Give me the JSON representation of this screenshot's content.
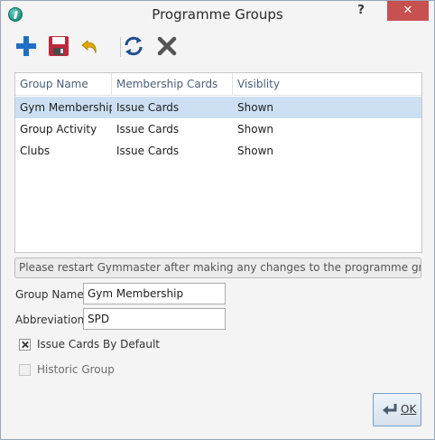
{
  "window": {
    "title": "Programme Groups",
    "help_glyph": "?",
    "close_glyph": "✕"
  },
  "toolbar": {
    "tools": [
      {
        "name": "add-icon"
      },
      {
        "name": "save-icon"
      },
      {
        "name": "undo-icon"
      },
      {
        "name": "refresh-icon"
      },
      {
        "name": "delete-icon"
      }
    ]
  },
  "list": {
    "columns": [
      "Group Name",
      "Membership Cards",
      "Visiblity"
    ],
    "rows": [
      {
        "group": "Gym Membership",
        "cards": "Issue Cards",
        "visibility": "Shown",
        "selected": true
      },
      {
        "group": "Group Activity",
        "cards": "Issue Cards",
        "visibility": "Shown",
        "selected": false
      },
      {
        "group": "Clubs",
        "cards": "Issue Cards",
        "visibility": "Shown",
        "selected": false
      }
    ]
  },
  "notice": "Please restart Gymmaster after making any changes to the programme groups",
  "form": {
    "group_name_label": "Group Name",
    "group_name_value": "Gym Membership",
    "abbreviation_label": "Abbreviation",
    "abbreviation_value": "SPD",
    "issue_cards_label": "Issue Cards By Default",
    "issue_cards_checked": true,
    "historic_label": "Historic Group",
    "historic_checked": false
  },
  "ok_button": {
    "label": "OK"
  },
  "colors": {
    "selection": "#cde0f3",
    "close_button": "#c75050",
    "add_icon": "#1f6fc4",
    "save_icon": "#c0283a",
    "undo_icon": "#e0a800",
    "refresh_icon": "#1e4e8c",
    "delete_icon": "#555555"
  }
}
